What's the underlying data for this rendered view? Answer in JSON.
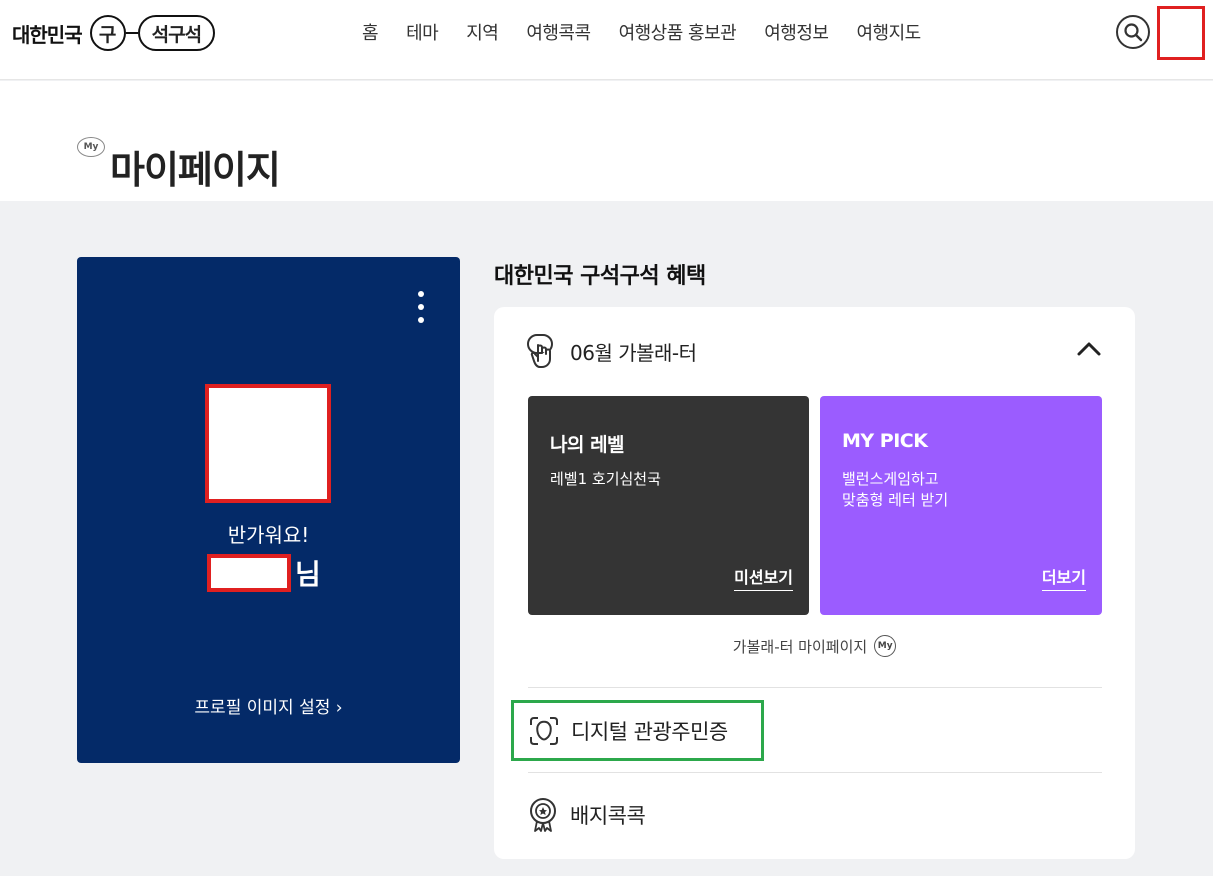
{
  "header": {
    "logo": {
      "prefix": "대한민국",
      "circle": "구",
      "pill": "석구석"
    },
    "nav": [
      "홈",
      "테마",
      "지역",
      "여행콕콕",
      "여행상품 홍보관",
      "여행정보",
      "여행지도"
    ]
  },
  "page": {
    "my_badge": "My",
    "title": "마이페이지"
  },
  "profile": {
    "greeting": "반가워요!",
    "suffix": "님",
    "image_setting": "프로필 이미지 설정 ›"
  },
  "benefits": {
    "title": "대한민국 구석구석 혜택",
    "accordion_label": "06월 가볼래-터",
    "level_card": {
      "title": "나의 레벨",
      "desc": "레벨1 호기심천국",
      "link": "미션보기"
    },
    "pick_card": {
      "title": "MY PICK",
      "desc": "밸런스게임하고\n맞춤형 레터 받기",
      "link": "더보기"
    },
    "mypage_link": "가볼래-터 마이페이지",
    "mypage_badge": "My",
    "digital_id": "디지털 관광주민증",
    "badge_collect": "배지콕콕"
  },
  "colors": {
    "profile_bg": "#042a68",
    "dark_card": "#343434",
    "purple_card": "#9b5cff",
    "redaction": "#e02020",
    "highlight": "#2ca84b"
  }
}
